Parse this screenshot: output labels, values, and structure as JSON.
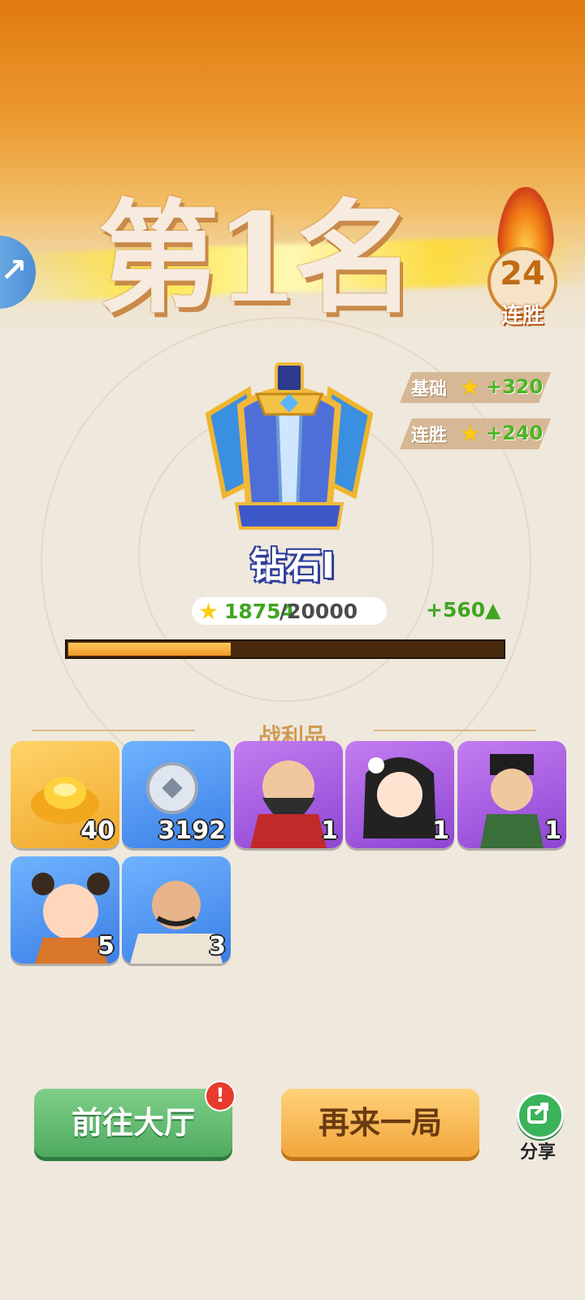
{
  "result": {
    "rank_text": "第1名",
    "streak_count": "24",
    "streak_label": "连胜"
  },
  "bonuses": [
    {
      "label": "基础",
      "value": "+320"
    },
    {
      "label": "连胜",
      "value": "+240"
    }
  ],
  "tier": {
    "name": "钻石Ⅰ"
  },
  "score": {
    "current": "18754",
    "max": "/20000",
    "gain": "+560▲",
    "progress_fraction": 0.374
  },
  "loot": {
    "title": "战利品",
    "items": [
      {
        "icon": "gold-ingot-icon",
        "qty": "40",
        "bg": "gold"
      },
      {
        "icon": "silver-coin-icon",
        "qty": "3192",
        "bg": "blue"
      },
      {
        "icon": "bearded-general-portrait",
        "qty": "1",
        "bg": "purple"
      },
      {
        "icon": "girl-with-flower-portrait",
        "qty": "1",
        "bg": "purple"
      },
      {
        "icon": "official-with-hat-portrait",
        "qty": "1",
        "bg": "purple"
      },
      {
        "icon": "child-portrait",
        "qty": "5",
        "bg": "blue"
      },
      {
        "icon": "mustached-warrior-portrait",
        "qty": "3",
        "bg": "blue"
      }
    ]
  },
  "buttons": {
    "lobby": "前往大厅",
    "lobby_alert": "!",
    "again": "再来一局",
    "share": "分享"
  },
  "colors": {
    "accent_orange": "#f2a53a",
    "accent_green": "#4faa60",
    "gain_green": "#41a523"
  }
}
